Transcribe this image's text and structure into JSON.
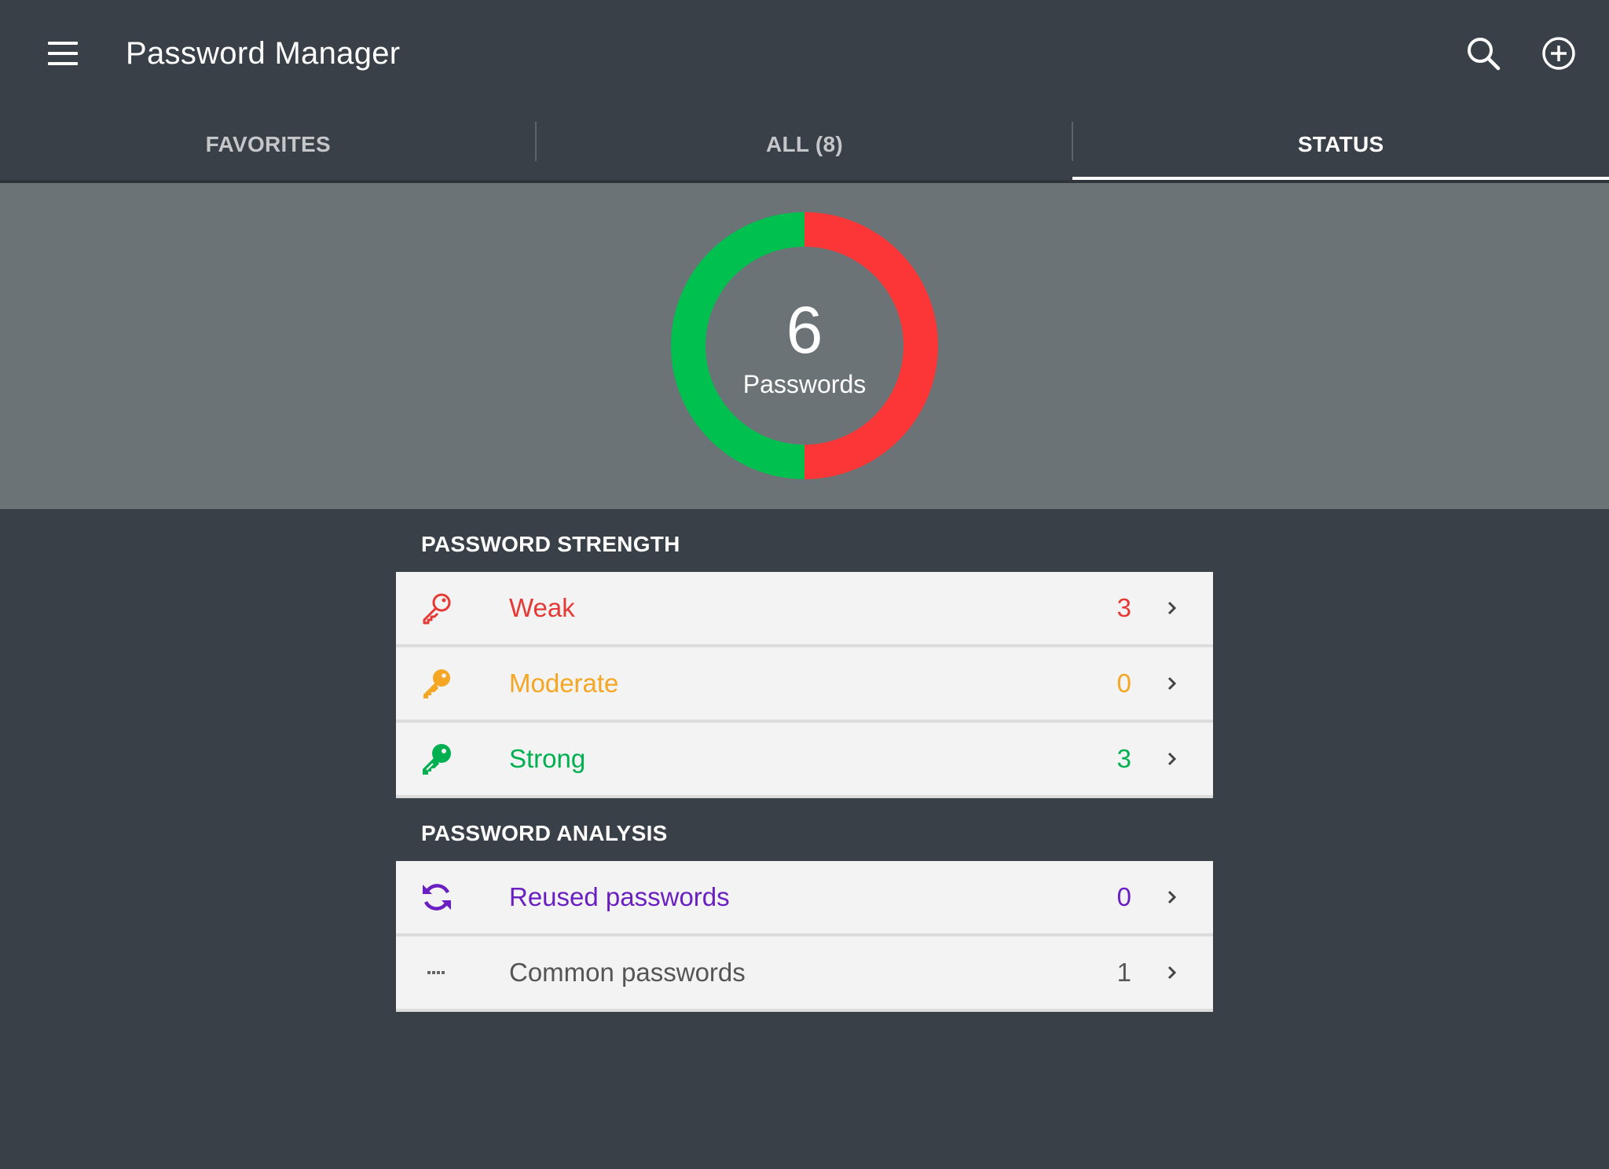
{
  "appbar": {
    "title": "Password Manager",
    "menu_icon": "hamburger-menu-icon",
    "search_icon": "search-icon",
    "add_icon": "add-circle-icon"
  },
  "tabs": [
    {
      "label": "FAVORITES",
      "active": false
    },
    {
      "label": "ALL (8)",
      "active": false
    },
    {
      "label": "STATUS",
      "active": true
    }
  ],
  "summary": {
    "count": "6",
    "label": "Passwords",
    "segments": [
      {
        "name": "Strong",
        "value": 3,
        "color": "#00c050"
      },
      {
        "name": "Weak",
        "value": 3,
        "color": "#fc3636"
      }
    ]
  },
  "strength": {
    "header": "PASSWORD STRENGTH",
    "items": [
      {
        "label": "Weak",
        "count": "3",
        "color": "#e53935",
        "icon": "key-outline-icon"
      },
      {
        "label": "Moderate",
        "count": "0",
        "color": "#f5a623",
        "icon": "key-icon"
      },
      {
        "label": "Strong",
        "count": "3",
        "color": "#00b050",
        "icon": "key-filled-icon"
      }
    ]
  },
  "analysis": {
    "header": "PASSWORD ANALYSIS",
    "items": [
      {
        "label": "Reused passwords",
        "count": "0",
        "color": "#6a1fc2",
        "icon": "refresh-icon"
      },
      {
        "label": "Common passwords",
        "count": "1",
        "color": "#555555",
        "icon": "password-dots-icon"
      }
    ]
  }
}
